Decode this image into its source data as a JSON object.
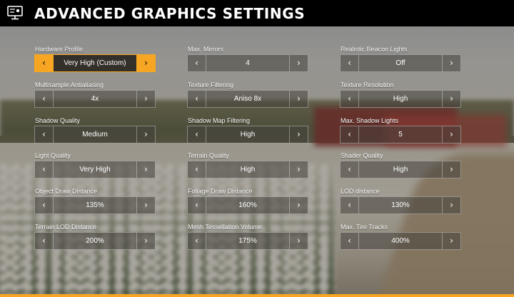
{
  "header": {
    "title": "ADVANCED GRAPHICS SETTINGS",
    "icon": "monitor-settings-icon"
  },
  "accent_color": "#f6a623",
  "settings": [
    {
      "label": "Hardware Profile",
      "value": "Very High (Custom)",
      "active": true
    },
    {
      "label": "Max. Mirrors",
      "value": "4"
    },
    {
      "label": "Realistic Beacon Lights",
      "value": "Off"
    },
    {
      "label": "Multisample Antialiasing",
      "value": "4x"
    },
    {
      "label": "Texture Filtering",
      "value": "Aniso 8x"
    },
    {
      "label": "Texture Resolution",
      "value": "High"
    },
    {
      "label": "Shadow Quality",
      "value": "Medium"
    },
    {
      "label": "Shadow Map Filtering",
      "value": "High"
    },
    {
      "label": "Max. Shadow Lights",
      "value": "5"
    },
    {
      "label": "Light Quality",
      "value": "Very High"
    },
    {
      "label": "Terrain Quality",
      "value": "High"
    },
    {
      "label": "Shader Quality",
      "value": "High"
    },
    {
      "label": "Object Draw Distance",
      "value": "135%"
    },
    {
      "label": "Foliage Draw Distance",
      "value": "160%"
    },
    {
      "label": "LOD distance",
      "value": "130%"
    },
    {
      "label": "Terrain LOD Distance",
      "value": "200%"
    },
    {
      "label": "Mesh Tessellation Volume",
      "value": "175%"
    },
    {
      "label": "Max. Tire Tracks",
      "value": "400%"
    }
  ],
  "arrows": {
    "left": "‹",
    "right": "›"
  }
}
